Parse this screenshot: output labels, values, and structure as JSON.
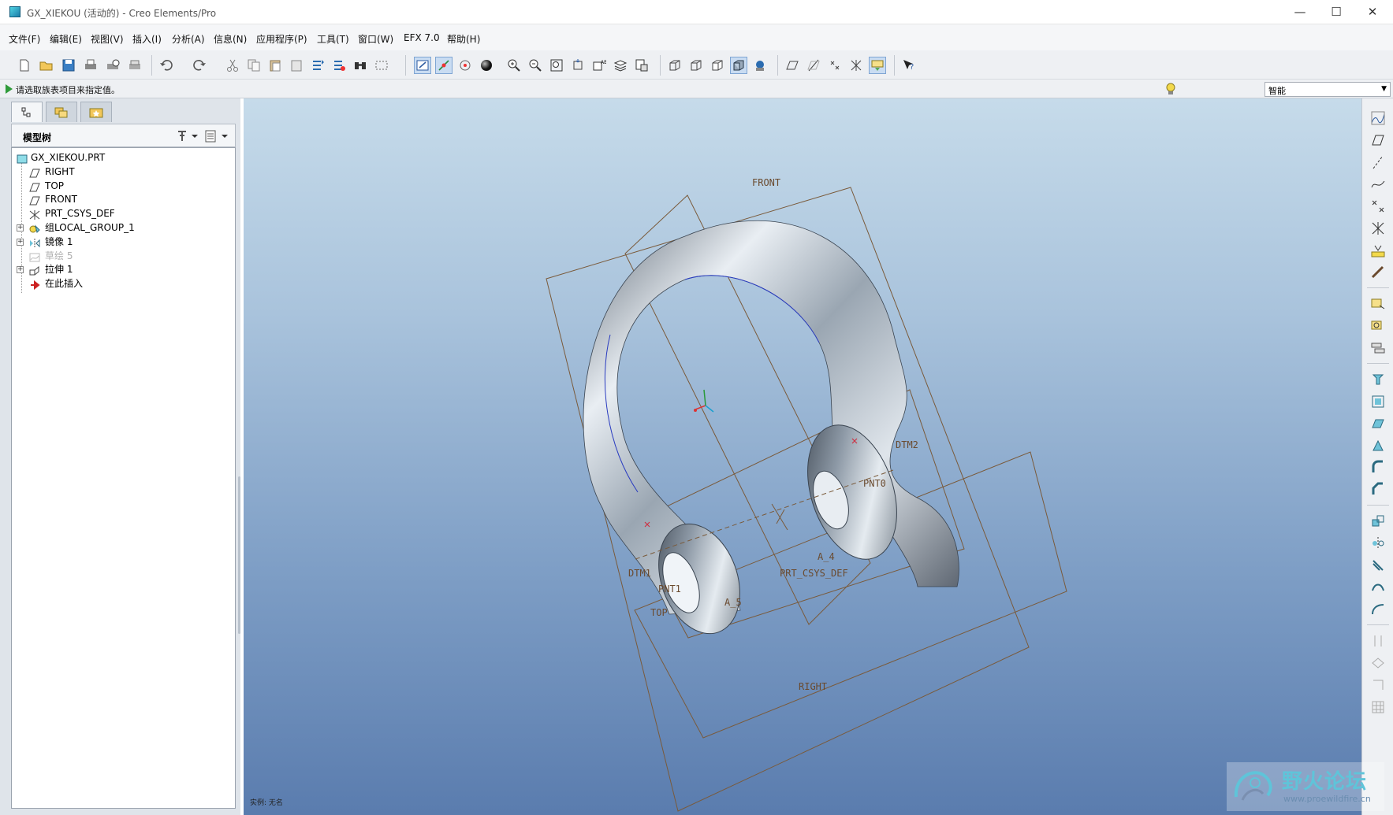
{
  "window": {
    "title": "GX_XIEKOU (活动的) - Creo Elements/Pro",
    "minimize": "—",
    "maximize": "☐",
    "close": "✕"
  },
  "menu": [
    "文件(F)",
    "编辑(E)",
    "视图(V)",
    "插入(I)",
    "分析(A)",
    "信息(N)",
    "应用程序(P)",
    "工具(T)",
    "窗口(W)",
    "EFX 7.0",
    "帮助(H)"
  ],
  "message": "请选取族表项目来指定值。",
  "filter": {
    "value": "智能"
  },
  "left_panel": {
    "title": "模型树",
    "tabs": [
      "model-tree-tab",
      "layers-tab",
      "favorites-tab"
    ]
  },
  "tree": [
    {
      "label": "GX_XIEKOU.PRT",
      "icon": "part-icon",
      "expandable": false,
      "suppressed": false
    },
    {
      "label": "RIGHT",
      "icon": "datum-plane-icon",
      "expandable": false,
      "suppressed": false
    },
    {
      "label": "TOP",
      "icon": "datum-plane-icon",
      "expandable": false,
      "suppressed": false
    },
    {
      "label": "FRONT",
      "icon": "datum-plane-icon",
      "expandable": false,
      "suppressed": false
    },
    {
      "label": "PRT_CSYS_DEF",
      "icon": "csys-icon",
      "expandable": false,
      "suppressed": false
    },
    {
      "label": "组LOCAL_GROUP_1",
      "icon": "group-icon",
      "expandable": true,
      "suppressed": false
    },
    {
      "label": "镜像 1",
      "icon": "mirror-icon",
      "expandable": true,
      "suppressed": false
    },
    {
      "label": "草绘 5",
      "icon": "sketch-icon",
      "expandable": false,
      "suppressed": true
    },
    {
      "label": "拉伸 1",
      "icon": "extrude-icon",
      "expandable": true,
      "suppressed": false
    },
    {
      "label": "在此插入",
      "icon": "insert-here-icon",
      "expandable": false,
      "suppressed": false
    }
  ],
  "viewport": {
    "datum_labels": {
      "front": "FRONT",
      "right": "RIGHT",
      "top": "TOP",
      "dtm1": "DTM1",
      "dtm2": "DTM2",
      "pnt0": "PNT0",
      "pnt1": "PNT1",
      "a4": "A_4",
      "a5": "A_5",
      "csys": "PRT_CSYS_DEF"
    },
    "status": "实例: 无名"
  },
  "watermark": {
    "name": "野火论坛",
    "url": "www.proewildfire.cn"
  }
}
